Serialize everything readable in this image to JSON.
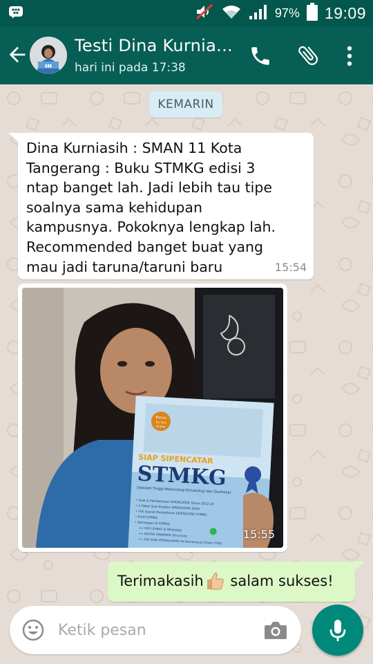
{
  "status_bar": {
    "battery_percent": "97%",
    "time": "19:09",
    "icons": [
      "bbm-icon",
      "mute-icon",
      "wifi-icon",
      "signal-icon",
      "battery-icon"
    ]
  },
  "header": {
    "contact_name": "Testi Dina Kurnia...",
    "contact_status": "hari ini pada 17:38",
    "icons": [
      "back-arrow-icon",
      "phone-icon",
      "paperclip-icon",
      "more-vert-icon"
    ]
  },
  "chat": {
    "date_chip": "KEMARIN",
    "messages": [
      {
        "direction": "incoming",
        "type": "text",
        "lines": [
          "Dina Kurniasih : SMAN 11 Kota",
          "Tangerang : Buku STMKG edisi 3",
          "ntap banget lah. Jadi lebih tau tipe",
          "soalnya sama kehidupan",
          "kampusnya. Pokoknya lengkap lah.",
          "Recommended banget buat yang",
          "mau jadi taruna/taruni baru"
        ],
        "time": "15:54"
      },
      {
        "direction": "incoming",
        "type": "image",
        "time": "15:55",
        "book_text": {
          "badge": "Bonus Try Out Online",
          "title_small": "SIAP SIPENCATAR",
          "title_big": "STMKG",
          "subtitle": "(Sekolah Tinggi Meteorologi Klimatologi dan Geofisika)",
          "list": [
            "Soal & Pembahasan SIPENCATAR Tahun 2012-20",
            "2 Paket Soal Prediksi SIPENCATAR 2016",
            "Info Syarat Pendaftaran SIPENCATAR STMKG",
            "Profil STMKG",
            "Kehidupan di STMKG",
            "++ INFO STMKG di WhatsApp",
            "++ MATERI GRAMMAR (Structure)",
            "++ 200 SOAL PENDALAMAN Tes Kemampuan Dasar (TKD)"
          ]
        }
      },
      {
        "direction": "outgoing",
        "type": "text",
        "text_before": "Terimakasih",
        "emoji": "thumbs-up",
        "text_after": " salam sukses!"
      }
    ]
  },
  "composer": {
    "placeholder": "Ketik pesan",
    "icons": [
      "emoji-icon",
      "camera-icon",
      "mic-icon"
    ]
  },
  "colors": {
    "status_bar": "#03574c",
    "app_bar": "#075e54",
    "chat_bg": "#e5ddd5",
    "outgoing_bubble": "#dcf8c6",
    "mic_button": "#00897b"
  }
}
